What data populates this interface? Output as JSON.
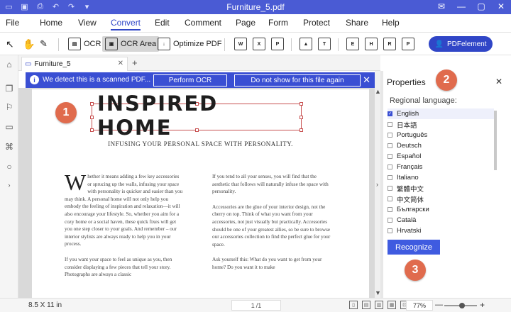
{
  "app": {
    "title": "Furniture_5.pdf",
    "accent_color": "#4a5bd4"
  },
  "quick_access": [
    "folder-icon",
    "save-icon",
    "print-icon",
    "undo-icon",
    "redo-icon",
    "customize-icon"
  ],
  "window_controls": [
    "notification-icon",
    "minimize-icon",
    "maximize-icon",
    "close-icon"
  ],
  "menu": {
    "items": [
      "File",
      "Home",
      "View",
      "Convert",
      "Edit",
      "Comment",
      "Page",
      "Form",
      "Protect",
      "Share",
      "Help"
    ],
    "active": "Convert"
  },
  "toolbar": {
    "ocr_label": "OCR",
    "ocr_area_label": "OCR Area",
    "optimize_label": "Optimize PDF",
    "pdfelement_label": "PDFelement",
    "convert_icons": [
      "to-word-icon",
      "to-excel-icon",
      "to-ppt-icon",
      "to-image-icon",
      "to-text-icon",
      "to-epub-icon",
      "to-html-icon",
      "to-rtf-icon",
      "to-pdfa-icon"
    ]
  },
  "tabs": {
    "doc_tab": "Furniture_5",
    "new_tab": "+"
  },
  "banner": {
    "message": "We detect this is a scanned PDF...",
    "perform_ocr": "Perform OCR",
    "do_not_show": "Do not show for this file again",
    "close": "✕"
  },
  "document": {
    "heading": "INSPIRED HOME",
    "subheading": "INFUSING YOUR PERSONAL SPACE WITH PERSONALITY.",
    "col1_p1_dropcap": "W",
    "col1_p1": "hether it means adding a few key accessories or sprucing up the walls, infusing your space with personality is quicker and easier than you may think. A personal home will not only help you embody the feeling of inspiration and relaxation—it will also encourage your lifestyle. So, whether you aim for a cozy home or a social haven, these quick fixes will get you one step closer to your goals. And remember – our interior stylists are always ready to help you in your process.",
    "col1_p2": "If you want your space to feel as unique as you, then consider displaying a few pieces that tell your story. Photographs are always a classic",
    "col2_p1": "If you tend to all your senses, you will find that the aesthetic that follows will naturally infuse the space with personality.",
    "col2_p2": "Accessories are the glue of your interior design, not the cherry on top. Think of what you want from your accessories, not just visually but practically. Accessories should be one of your greatest allies, so be sure to browse our accessories collection to find the perfect glue for your space.",
    "col2_p3": "Ask yourself this: What do you want to get from your home? Do you want it to make"
  },
  "panel": {
    "title": "Properties",
    "close": "✕",
    "region_label": "Regional language:",
    "languages": [
      "English",
      "日本語",
      "Português",
      "Deutsch",
      "Español",
      "Français",
      "Italiano",
      "繁體中文",
      "中文简体",
      "Български",
      "Català",
      "Hrvatski"
    ],
    "checked": "English",
    "recognize_label": "Recognize"
  },
  "callouts": [
    "1",
    "2",
    "3"
  ],
  "status": {
    "page_size": "8.5 X 11 in",
    "page_current": "1",
    "page_total": "/1",
    "zoom": "77%",
    "zoom_fraction": 0.55,
    "zoom_minus": "—",
    "zoom_plus": "+"
  }
}
